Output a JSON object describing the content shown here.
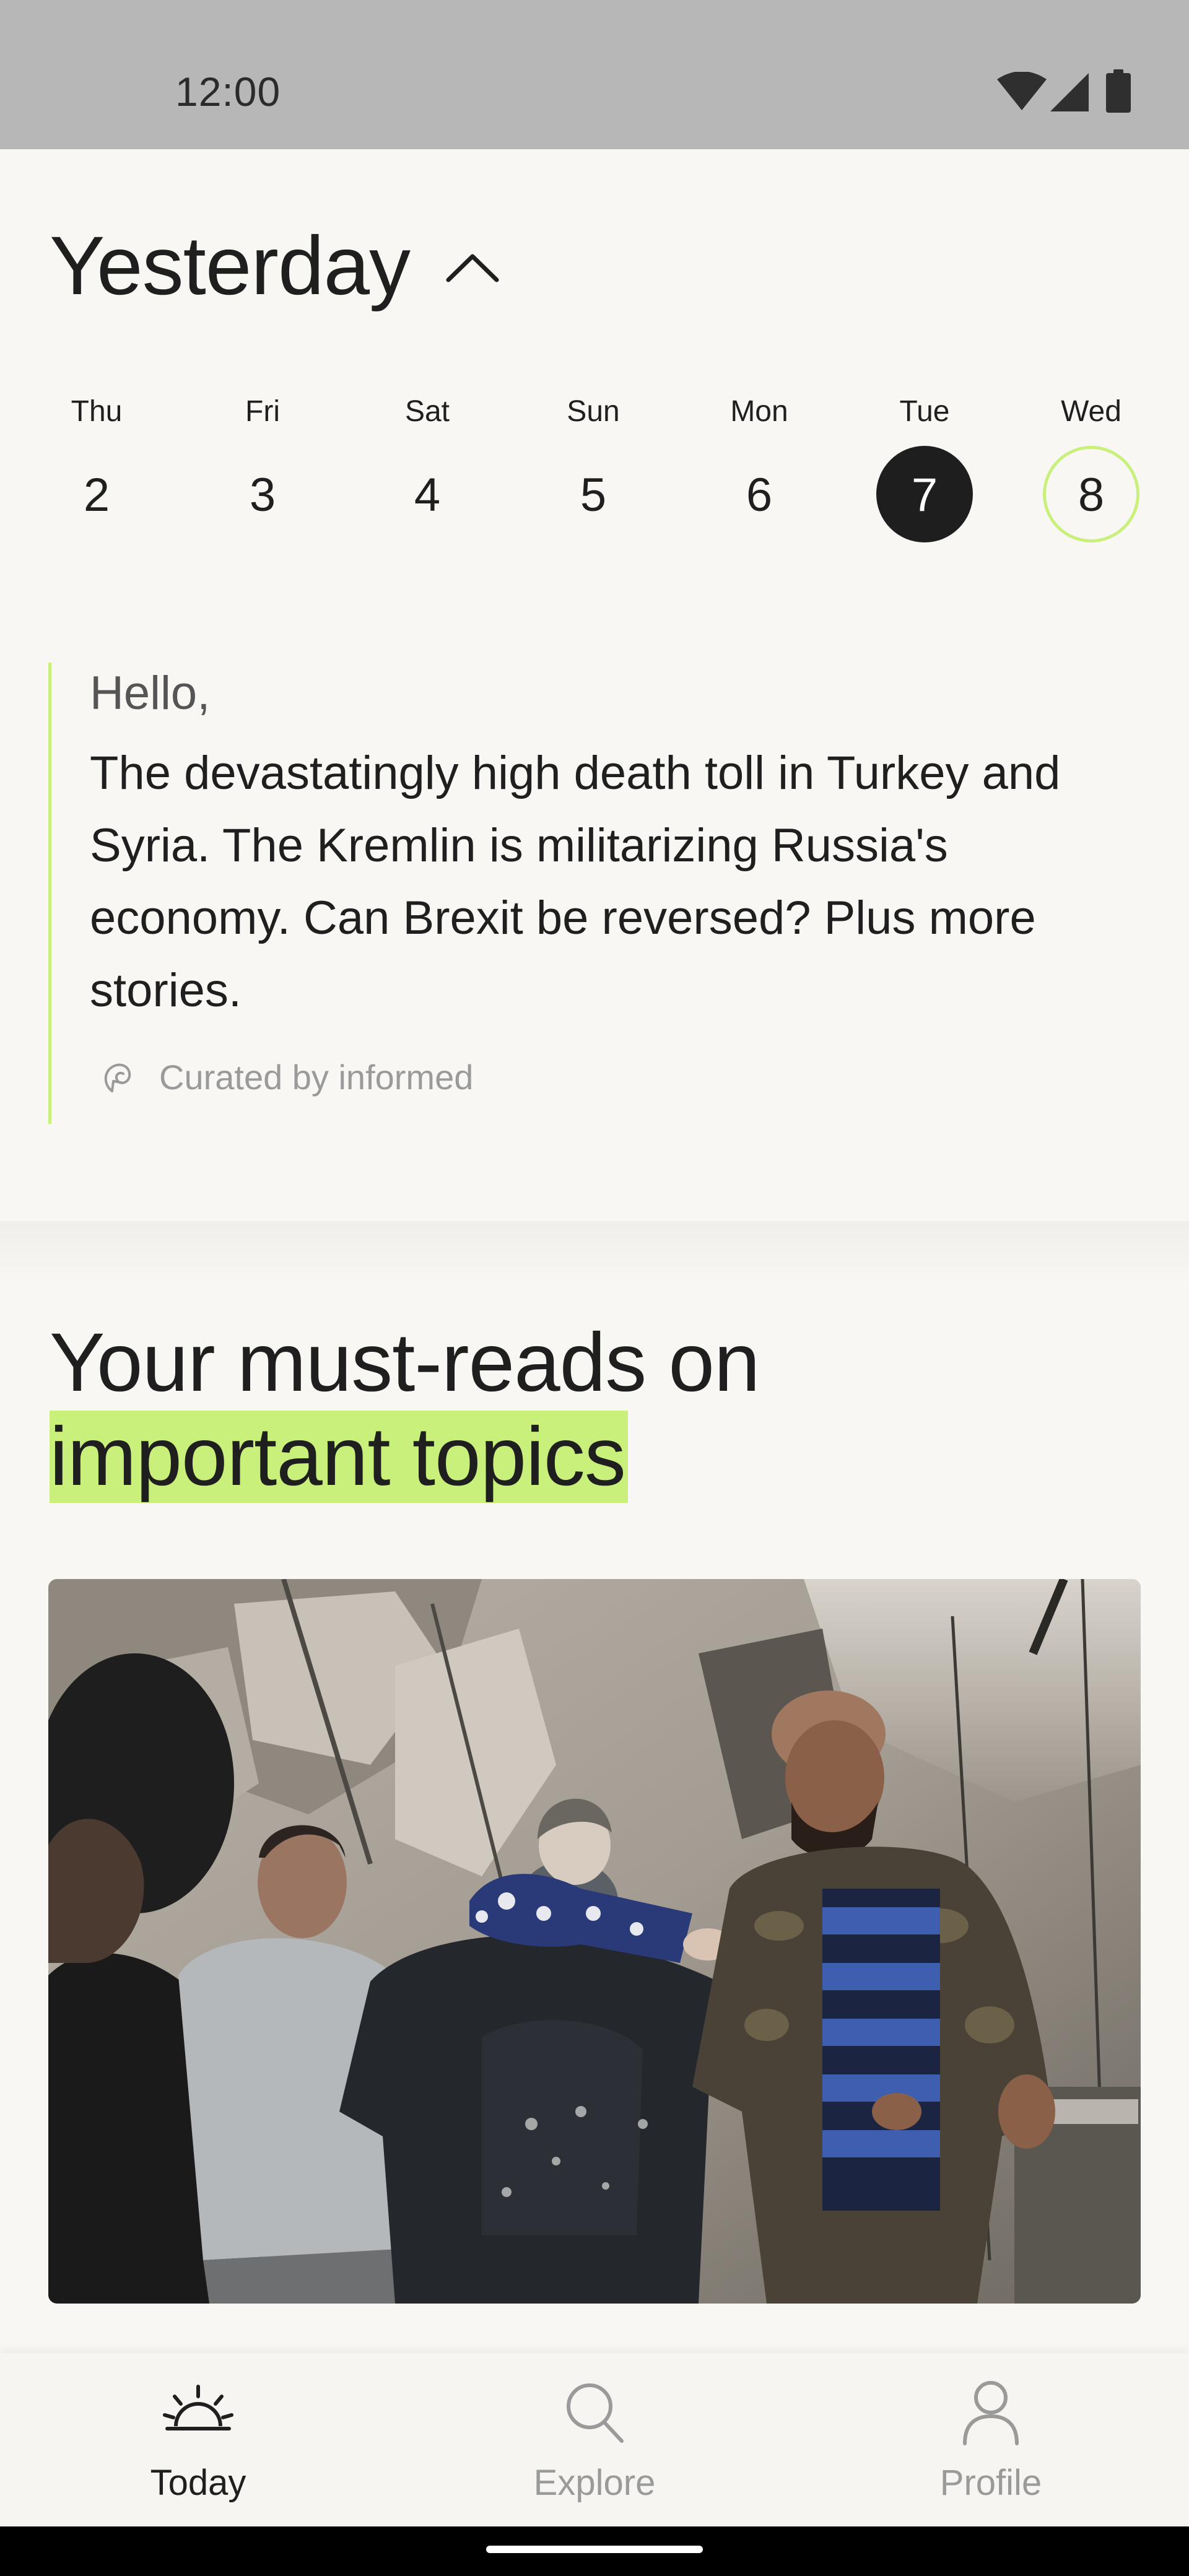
{
  "status_bar": {
    "time": "12:00",
    "icons": [
      "wifi-icon",
      "signal-icon",
      "battery-icon"
    ]
  },
  "header": {
    "title": "Yesterday",
    "toggle_icon": "chevron-up-icon"
  },
  "days": [
    {
      "name": "Thu",
      "number": "2",
      "state": "normal"
    },
    {
      "name": "Fri",
      "number": "3",
      "state": "normal"
    },
    {
      "name": "Sat",
      "number": "4",
      "state": "normal"
    },
    {
      "name": "Sun",
      "number": "5",
      "state": "normal"
    },
    {
      "name": "Mon",
      "number": "6",
      "state": "normal"
    },
    {
      "name": "Tue",
      "number": "7",
      "state": "selected"
    },
    {
      "name": "Wed",
      "number": "8",
      "state": "today"
    }
  ],
  "summary": {
    "greeting": "Hello,",
    "text": "The devastatingly high death toll in Turkey and Syria. The Kremlin is militarizing Russia's economy. Can Brexit be reversed? Plus more stories.",
    "curated_by": "Curated by informed",
    "curated_icon": "informed-logo-icon"
  },
  "must_reads": {
    "title_line1": "Your must-reads on",
    "title_highlight": "important topics",
    "image_icon": "rescue-photo"
  },
  "bottom_nav": {
    "items": [
      {
        "label": "Today",
        "icon": "sunrise-icon",
        "active": true
      },
      {
        "label": "Explore",
        "icon": "search-icon",
        "active": false
      },
      {
        "label": "Profile",
        "icon": "person-icon",
        "active": false
      }
    ]
  },
  "colors": {
    "accent": "#c8f07a",
    "text": "#1f1f1f",
    "muted": "#9a9a9a",
    "background": "#f8f7f4",
    "status_bar": "#b7b7b7",
    "selected_day": "#1e1e1e"
  }
}
